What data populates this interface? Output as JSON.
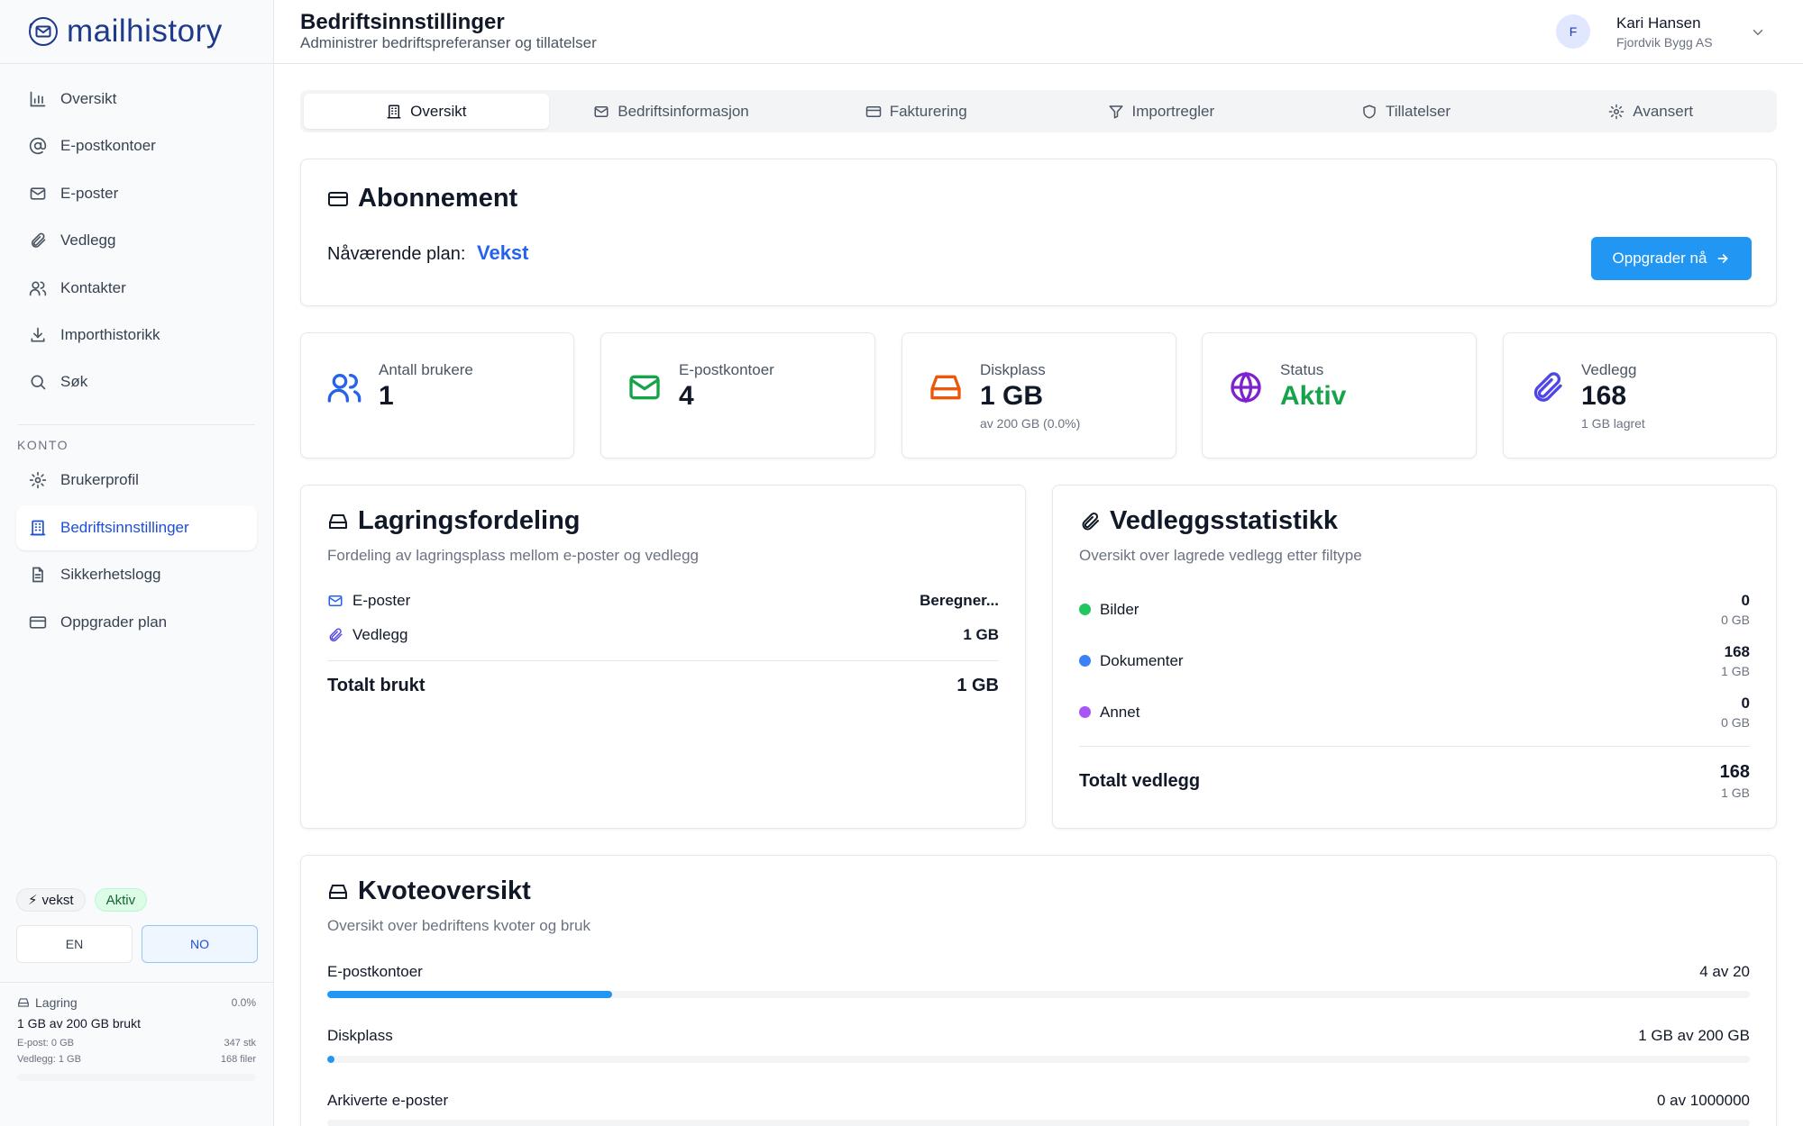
{
  "app": {
    "logo_text": "mailhistory"
  },
  "sidebar": {
    "main_items": [
      {
        "label": "Oversikt"
      },
      {
        "label": "E-postkontoer"
      },
      {
        "label": "E-poster"
      },
      {
        "label": "Vedlegg"
      },
      {
        "label": "Kontakter"
      },
      {
        "label": "Importhistorikk"
      },
      {
        "label": "Søk"
      }
    ],
    "section_label": "KONTO",
    "account_items": [
      {
        "label": "Brukerprofil"
      },
      {
        "label": "Bedriftsinnstillinger"
      },
      {
        "label": "Sikkerhetslogg"
      },
      {
        "label": "Oppgrader plan"
      }
    ],
    "plan_badge": "vekst",
    "status_badge": "Aktiv",
    "lang": {
      "en": "EN",
      "no": "NO"
    },
    "storage": {
      "title": "Lagring",
      "percent": "0.0%",
      "used": "1 GB av 200 GB brukt",
      "email_label": "E-post: 0 GB",
      "email_count": "347 stk",
      "attachments_label": "Vedlegg: 1 GB",
      "attachments_count": "168 filer",
      "fill_fraction": 0.0
    }
  },
  "header": {
    "title": "Bedriftsinnstillinger",
    "subtitle": "Administrer bedriftspreferanser og tillatelser",
    "avatar_initial": "F",
    "user_name": "Kari Hansen",
    "user_org": "Fjordvik Bygg AS"
  },
  "tabs": [
    {
      "label": "Oversikt"
    },
    {
      "label": "Bedriftsinformasjon"
    },
    {
      "label": "Fakturering"
    },
    {
      "label": "Importregler"
    },
    {
      "label": "Tillatelser"
    },
    {
      "label": "Avansert"
    }
  ],
  "subscription": {
    "title": "Abonnement",
    "plan_label": "Nåværende plan:",
    "plan_value": "Vekst",
    "upgrade_label": "Oppgrader nå"
  },
  "stats": [
    {
      "label": "Antall brukere",
      "value": "1",
      "note": ""
    },
    {
      "label": "E-postkontoer",
      "value": "4",
      "note": ""
    },
    {
      "label": "Diskplass",
      "value": "1 GB",
      "note": "av 200 GB (0.0%)"
    },
    {
      "label": "Status",
      "value": "Aktiv",
      "note": ""
    },
    {
      "label": "Vedlegg",
      "value": "168",
      "note": "1 GB lagret"
    }
  ],
  "storage_dist": {
    "title": "Lagringsfordeling",
    "subtitle": "Fordeling av lagringsplass mellom e-poster og vedlegg",
    "emails_label": "E-poster",
    "emails_value": "Beregner...",
    "attachments_label": "Vedlegg",
    "attachments_value": "1 GB",
    "total_label": "Totalt brukt",
    "total_value": "1 GB"
  },
  "attachment_stats": {
    "title": "Vedleggsstatistikk",
    "subtitle": "Oversikt over lagrede vedlegg etter filtype",
    "rows": [
      {
        "label": "Bilder",
        "count": "0",
        "size": "0 GB",
        "color": "#22c55e"
      },
      {
        "label": "Dokumenter",
        "count": "168",
        "size": "1 GB",
        "color": "#3b82f6"
      },
      {
        "label": "Annet",
        "count": "0",
        "size": "0 GB",
        "color": "#a855f7"
      }
    ],
    "total_label": "Totalt vedlegg",
    "total_count": "168",
    "total_size": "1 GB"
  },
  "quota": {
    "title": "Kvoteoversikt",
    "subtitle": "Oversikt over bedriftens kvoter og bruk",
    "rows": [
      {
        "label": "E-postkontoer",
        "value": "4 av 20",
        "fraction": 0.2
      },
      {
        "label": "Diskplass",
        "value": "1 GB av 200 GB",
        "fraction": 0.005
      },
      {
        "label": "Arkiverte e-poster",
        "value": "0 av 1000000",
        "fraction": 0.0
      }
    ]
  },
  "colors": {
    "accent": "#2196f3",
    "active_nav": "#1d4ed8",
    "stat_users": "#2563eb",
    "stat_mail": "#16a34a",
    "stat_disk": "#ea580c",
    "stat_status": "#7e22ce",
    "stat_status_text": "#16a34a",
    "stat_attachments": "#4f46e5"
  },
  "icons": {
    "nav": [
      "bar-chart-icon",
      "at-sign-icon",
      "mail-icon",
      "paperclip-icon",
      "users-icon",
      "download-icon",
      "search-icon"
    ],
    "account": [
      "gear-icon",
      "building-icon",
      "file-text-icon",
      "credit-card-icon"
    ],
    "tabs": [
      "building-icon",
      "mail-icon",
      "credit-card-icon",
      "filter-icon",
      "shield-icon",
      "gear-icon"
    ]
  }
}
